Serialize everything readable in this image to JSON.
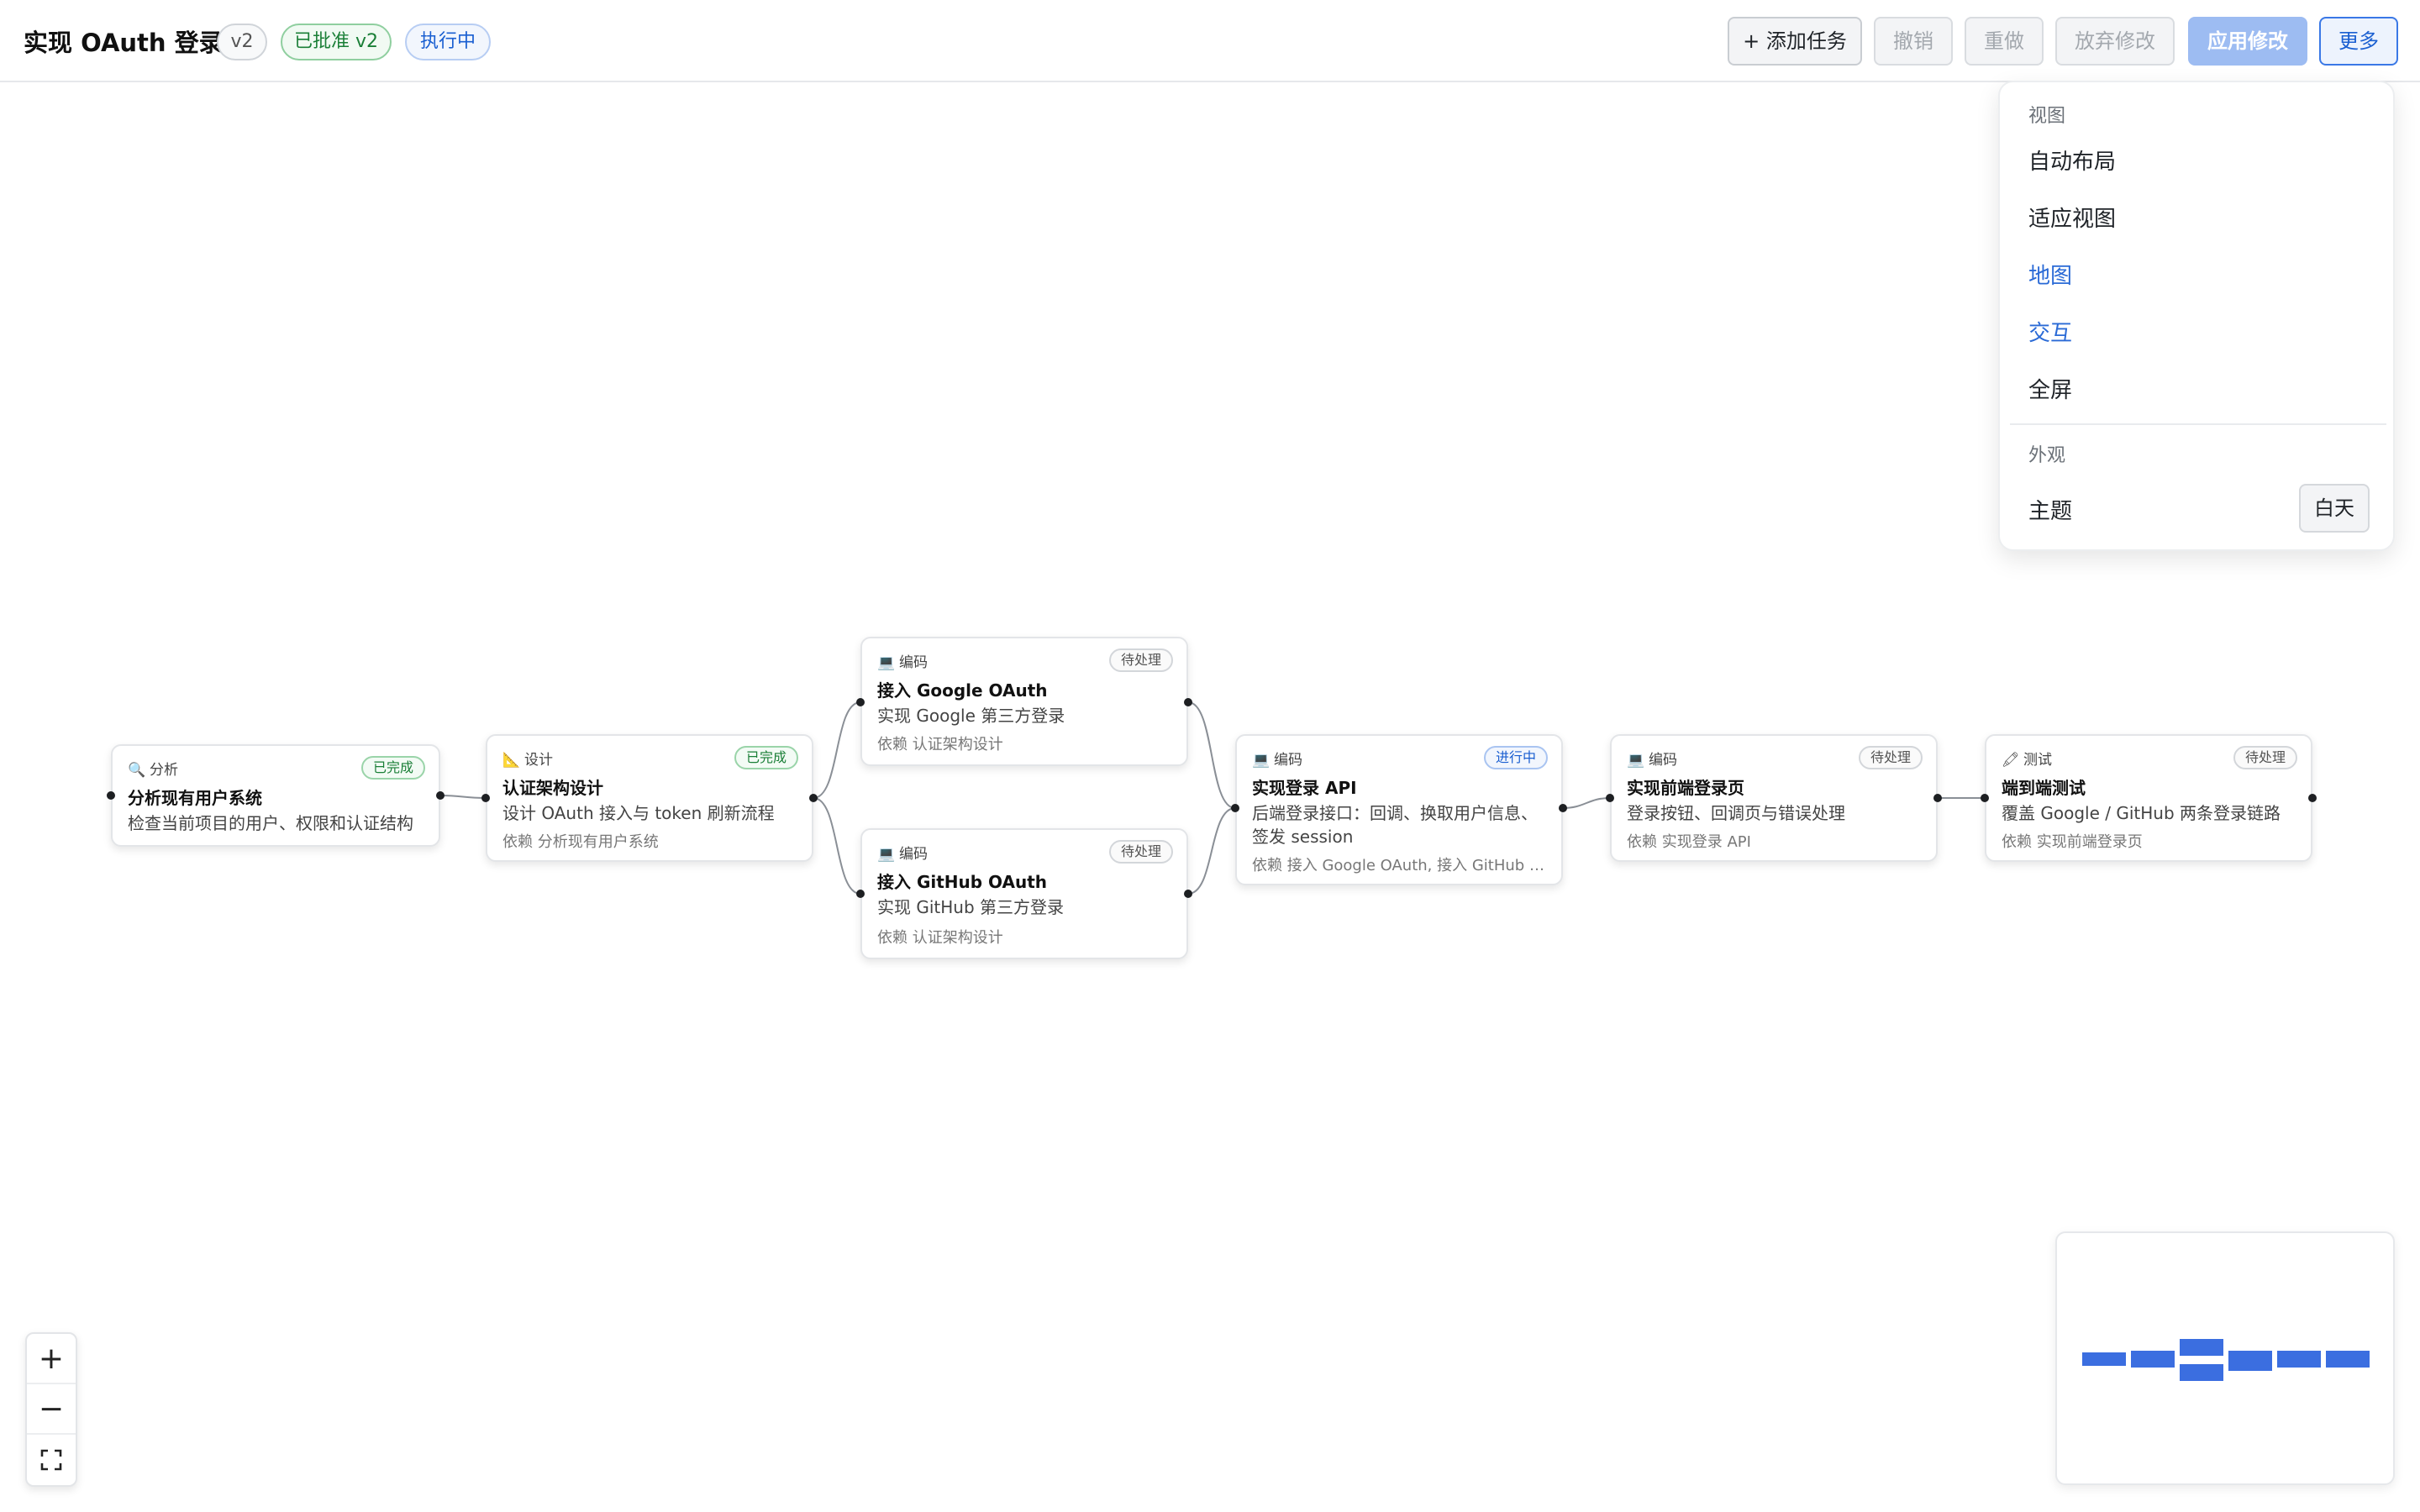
{
  "header": {
    "title": "实现 OAuth 登录",
    "version": "v2",
    "approved": "已批准 v2",
    "status": "执行中",
    "buttons": {
      "add_task": "+ 添加任务",
      "undo": "撤销",
      "redo": "重做",
      "discard": "放弃修改",
      "apply": "应用修改",
      "more": "更多"
    }
  },
  "menu": {
    "view_section": "视图",
    "auto_layout": "自动布局",
    "fit_view": "适应视图",
    "map": "地图",
    "interact": "交互",
    "fullscreen": "全屏",
    "appearance_section": "外观",
    "theme_label": "主题",
    "theme_value": "白天"
  },
  "nodes": {
    "analyze": {
      "type": "分析",
      "status": "已完成",
      "name": "分析现有用户系统",
      "desc": "检查当前项目的用户、权限和认证结构"
    },
    "design": {
      "type": "设计",
      "status": "已完成",
      "name": "认证架构设计",
      "desc": "设计 OAuth 接入与 token 刷新流程",
      "dep": "依赖 分析现有用户系统"
    },
    "google": {
      "type": "编码",
      "status": "待处理",
      "name": "接入 Google OAuth",
      "desc": "实现 Google 第三方登录",
      "dep": "依赖 认证架构设计"
    },
    "github": {
      "type": "编码",
      "status": "待处理",
      "name": "接入 GitHub OAuth",
      "desc": "实现 GitHub 第三方登录",
      "dep": "依赖 认证架构设计"
    },
    "api": {
      "type": "编码",
      "status": "进行中",
      "name": "实现登录 API",
      "desc": "后端登录接口：回调、换取用户信息、签发 session",
      "dep": "依赖 接入 Google OAuth, 接入 GitHub O..."
    },
    "frontend": {
      "type": "编码",
      "status": "待处理",
      "name": "实现前端登录页",
      "desc": "登录按钮、回调页与错误处理",
      "dep": "依赖 实现登录 API"
    },
    "e2e": {
      "type": "测试",
      "status": "待处理",
      "name": "端到端测试",
      "desc": "覆盖 Google / GitHub 两条登录链路",
      "dep": "依赖 实现前端登录页"
    }
  },
  "icons": {
    "analyze": "magnifier-icon",
    "design": "ruler-icon",
    "code": "laptop-icon",
    "test": "pencil-icon"
  },
  "colors": {
    "accent": "#3a78e6",
    "done": "#1a7f37",
    "minimap_node": "#3b6ee0"
  }
}
